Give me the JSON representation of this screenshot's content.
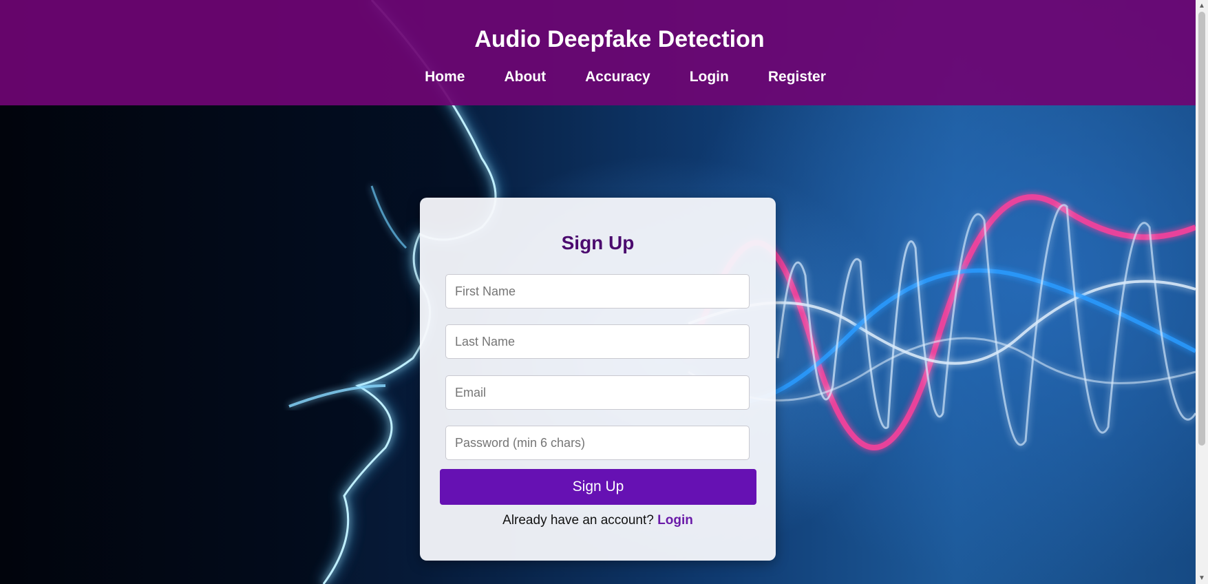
{
  "header": {
    "title": "Audio Deepfake Detection",
    "nav": [
      {
        "label": "Home"
      },
      {
        "label": "About"
      },
      {
        "label": "Accuracy"
      },
      {
        "label": "Login"
      },
      {
        "label": "Register"
      }
    ],
    "background_color": "#6e0573"
  },
  "signup": {
    "title": "Sign Up",
    "fields": {
      "first_name": {
        "placeholder": "First Name",
        "value": ""
      },
      "last_name": {
        "placeholder": "Last Name",
        "value": ""
      },
      "email": {
        "placeholder": "Email",
        "value": ""
      },
      "password": {
        "placeholder": "Password (min 6 chars)",
        "value": ""
      }
    },
    "submit_label": "Sign Up",
    "login_prompt": "Already have an account?",
    "login_link": "Login",
    "accent_color": "#6611b3"
  },
  "scrollbar": {
    "up_glyph": "▲",
    "down_glyph": "▼"
  }
}
